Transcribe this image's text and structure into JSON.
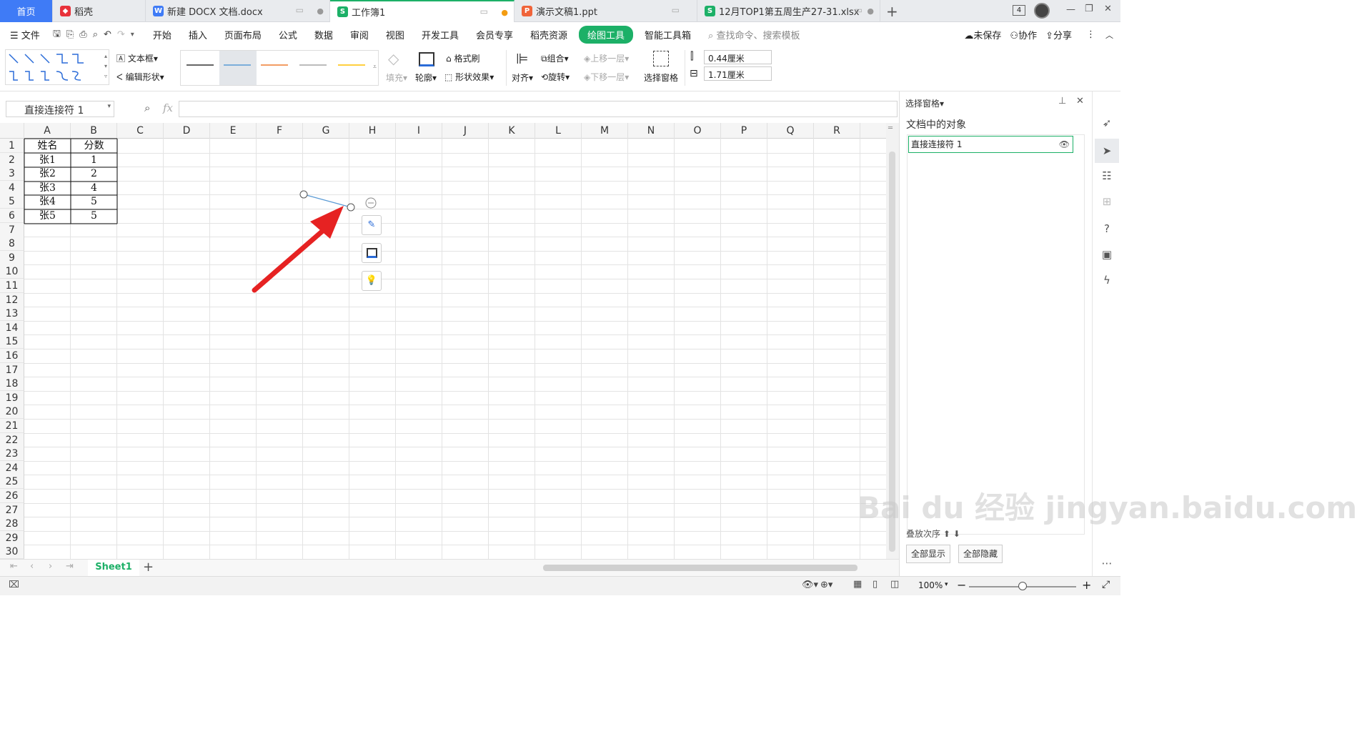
{
  "tabs": [
    {
      "label": "首页",
      "active": false,
      "home": true
    },
    {
      "label": "稻壳",
      "icon": "daoke",
      "color": "#e8313a"
    },
    {
      "label": "新建 DOCX 文档.docx",
      "icon": "W",
      "color": "#3f7bf6"
    },
    {
      "label": "工作簿1",
      "icon": "S",
      "color": "#1cb067",
      "active": true
    },
    {
      "label": "演示文稿1.ppt",
      "icon": "P",
      "color": "#f0643a"
    },
    {
      "label": "12月TOP1第五周生产27-31.xlsx",
      "icon": "S",
      "color": "#1cb067"
    }
  ],
  "tab_count_badge": "4",
  "menu": {
    "file": "文件",
    "items": [
      "开始",
      "插入",
      "页面布局",
      "公式",
      "数据",
      "审阅",
      "视图",
      "开发工具",
      "会员专享",
      "稻壳资源",
      "绘图工具",
      "智能工具箱"
    ],
    "active": "绘图工具",
    "search": "查找命令、搜索模板",
    "unsaved": "未保存",
    "collab": "协作",
    "share": "分享"
  },
  "ribbon": {
    "textbox": "文本框",
    "edit_shape": "编辑形状",
    "fill": "填充",
    "outline": "轮廓",
    "format_painter": "格式刷",
    "shape_effect": "形状效果",
    "align": "对齐",
    "group": "组合",
    "rotate": "旋转",
    "bring_forward": "上移一层",
    "send_backward": "下移一层",
    "selection_pane": "选择窗格",
    "height": "0.44厘米",
    "width": "1.71厘米",
    "line_colors": [
      "#333333",
      "#5b9bd5",
      "#ed7d31",
      "#a5a5a5",
      "#ffc000"
    ]
  },
  "formula": {
    "name_box": "直接连接符 1",
    "fx": "fx",
    "value": ""
  },
  "columns": [
    "A",
    "B",
    "C",
    "D",
    "E",
    "F",
    "G",
    "H",
    "I",
    "J",
    "K",
    "L",
    "M",
    "N",
    "O",
    "P",
    "Q",
    "R"
  ],
  "rows": [
    "1",
    "2",
    "3",
    "4",
    "5",
    "6",
    "7",
    "8",
    "9",
    "10",
    "11",
    "12",
    "13",
    "14",
    "15",
    "16",
    "17",
    "18",
    "19",
    "20",
    "21",
    "22",
    "23",
    "24",
    "25",
    "26",
    "27",
    "28",
    "29",
    "30"
  ],
  "table": {
    "header": [
      "姓名",
      "分数"
    ],
    "data": [
      [
        "张1",
        "1"
      ],
      [
        "张2",
        "2"
      ],
      [
        "张3",
        "4"
      ],
      [
        "张4",
        "5"
      ],
      [
        "张5",
        "5"
      ]
    ]
  },
  "sheet": {
    "name": "Sheet1",
    "add": "+"
  },
  "pane": {
    "title": "选择窗格",
    "subtitle": "文档中的对象",
    "object": "直接连接符 1",
    "order_label": "叠放次序",
    "show_all": "全部显示",
    "hide_all": "全部隐藏"
  },
  "status": {
    "zoom": "100%"
  },
  "watermark": "Bai du 经验  jingyan.baidu.com"
}
